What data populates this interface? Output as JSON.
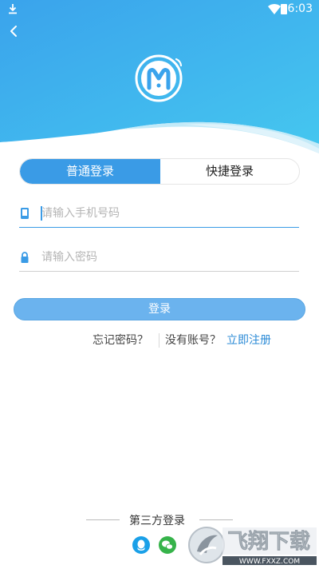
{
  "status_bar": {
    "time": "6:03"
  },
  "colors": {
    "primary": "#3a9be6",
    "button": "#6bb3ee",
    "link": "#2a8ad6"
  },
  "tabs": [
    {
      "label": "普通登录",
      "active": true
    },
    {
      "label": "快捷登录",
      "active": false
    }
  ],
  "form": {
    "phone": {
      "placeholder": "请输入手机号码",
      "value": "",
      "icon": "phone-icon"
    },
    "password": {
      "placeholder": "请输入密码",
      "value": "",
      "icon": "lock-icon"
    }
  },
  "login_button": {
    "label": "登录"
  },
  "links": {
    "forgot": "忘记密码？",
    "no_account": "没有账号？",
    "register": "立即注册"
  },
  "third_party": {
    "label": "第三方登录",
    "providers": [
      {
        "name": "qq",
        "icon": "qq-icon"
      },
      {
        "name": "wechat",
        "icon": "wechat-icon"
      }
    ]
  },
  "watermark": {
    "title": "飞翔下载",
    "url": "WWW.FXXZ.COM"
  }
}
